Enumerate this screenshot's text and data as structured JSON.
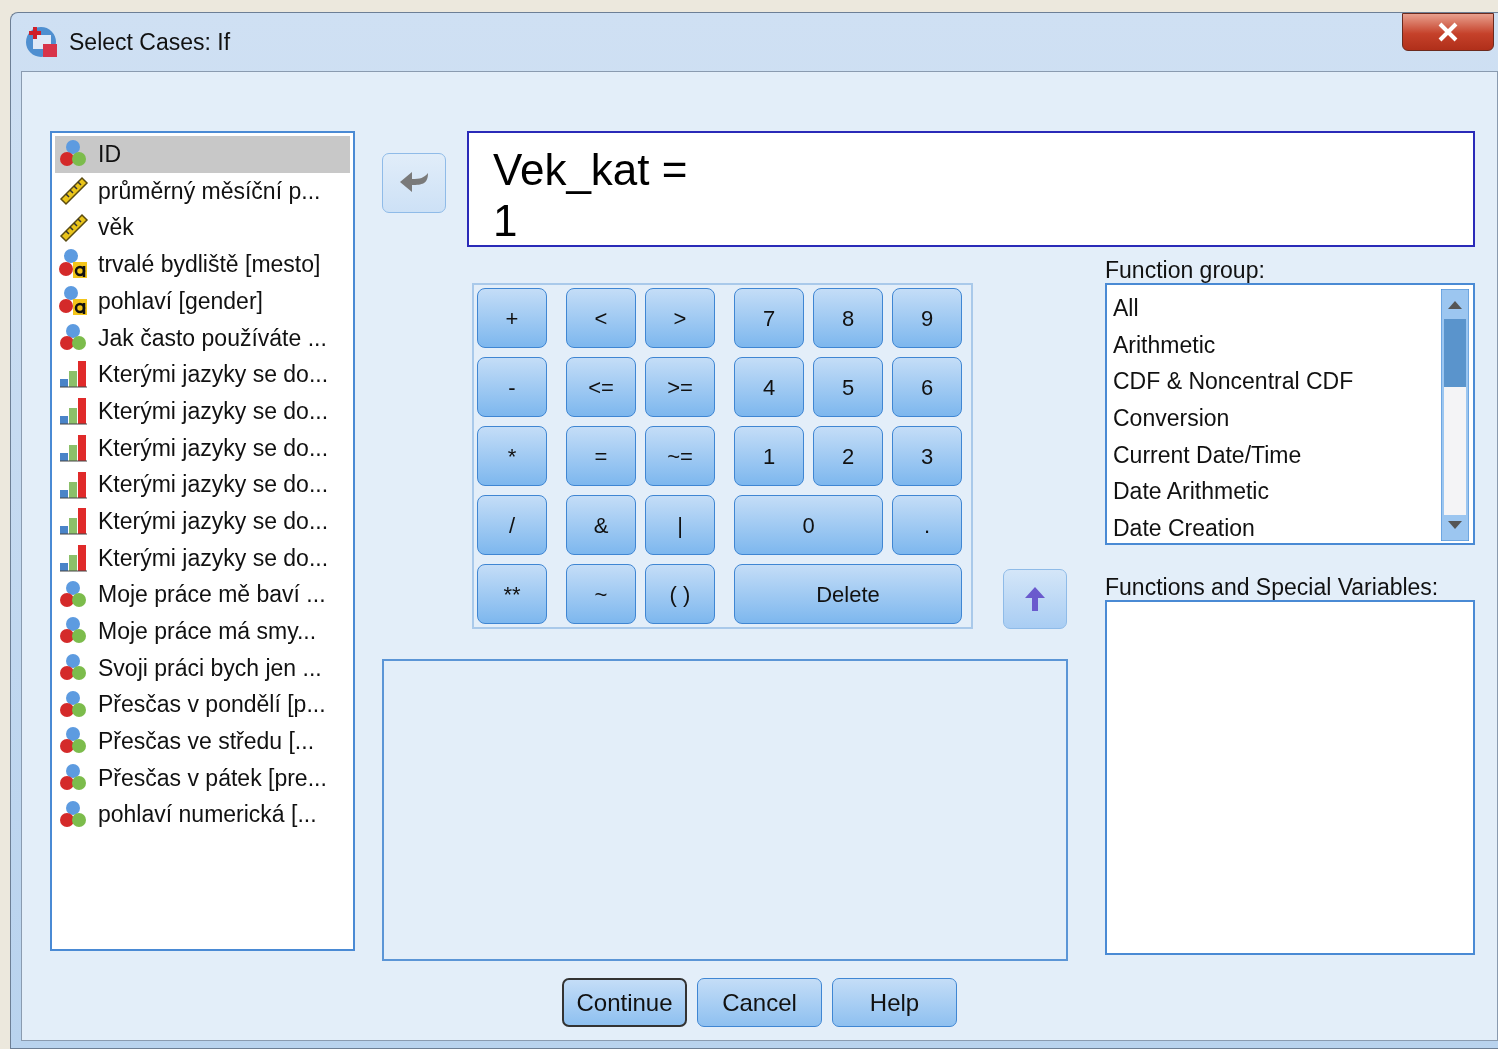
{
  "window": {
    "title": "Select Cases: If"
  },
  "variables": [
    {
      "label": "ID",
      "kind": "nominal",
      "selected": true
    },
    {
      "label": "průměrný měsíční p...",
      "kind": "scale",
      "selected": false
    },
    {
      "label": "věk",
      "kind": "scale",
      "selected": false
    },
    {
      "label": "trvalé bydliště [mesto]",
      "kind": "nominal_string",
      "selected": false
    },
    {
      "label": "pohlaví  [gender]",
      "kind": "nominal_string",
      "selected": false
    },
    {
      "label": "Jak často používáte ...",
      "kind": "nominal",
      "selected": false
    },
    {
      "label": "Kterými jazyky se do...",
      "kind": "ordinal",
      "selected": false
    },
    {
      "label": "Kterými jazyky se do...",
      "kind": "ordinal",
      "selected": false
    },
    {
      "label": "Kterými jazyky se do...",
      "kind": "ordinal",
      "selected": false
    },
    {
      "label": "Kterými jazyky se do...",
      "kind": "ordinal",
      "selected": false
    },
    {
      "label": "Kterými jazyky se do...",
      "kind": "ordinal",
      "selected": false
    },
    {
      "label": "Kterými jazyky se do...",
      "kind": "ordinal",
      "selected": false
    },
    {
      "label": "Moje práce mě baví ...",
      "kind": "nominal",
      "selected": false
    },
    {
      "label": "Moje práce má smy...",
      "kind": "nominal",
      "selected": false
    },
    {
      "label": "Svoji práci bych jen ...",
      "kind": "nominal",
      "selected": false
    },
    {
      "label": "Přesčas v pondělí [p...",
      "kind": "nominal",
      "selected": false
    },
    {
      "label": "Přesčas ve středu [...",
      "kind": "nominal",
      "selected": false
    },
    {
      "label": "Přesčas v pátek [pre...",
      "kind": "nominal",
      "selected": false
    },
    {
      "label": "pohlaví numerická [...",
      "kind": "nominal",
      "selected": false
    }
  ],
  "expression": "Vek_kat =\n1",
  "keypad": [
    {
      "kind": "operators",
      "keys": [
        {
          "label": "+",
          "kind": "normal"
        },
        {
          "label": "-",
          "kind": "normal"
        },
        {
          "label": "*",
          "kind": "normal"
        },
        {
          "label": "/",
          "kind": "normal"
        },
        {
          "label": "**",
          "kind": "normal"
        }
      ]
    },
    {
      "kind": "relations",
      "keys": [
        {
          "label": "<",
          "kind": "normal"
        },
        {
          "label": ">",
          "kind": "normal"
        },
        {
          "label": "<=",
          "kind": "normal"
        },
        {
          "label": ">=",
          "kind": "normal"
        },
        {
          "label": "=",
          "kind": "normal"
        },
        {
          "label": "~=",
          "kind": "normal"
        },
        {
          "label": "&",
          "kind": "normal"
        },
        {
          "label": "|",
          "kind": "normal"
        },
        {
          "label": "~",
          "kind": "normal"
        },
        {
          "label": "( )",
          "kind": "normal"
        }
      ]
    },
    {
      "kind": "digits",
      "keys": [
        {
          "label": "7",
          "kind": "normal"
        },
        {
          "label": "8",
          "kind": "normal"
        },
        {
          "label": "9",
          "kind": "normal"
        },
        {
          "label": "4",
          "kind": "normal"
        },
        {
          "label": "5",
          "kind": "normal"
        },
        {
          "label": "6",
          "kind": "normal"
        },
        {
          "label": "1",
          "kind": "normal"
        },
        {
          "label": "2",
          "kind": "normal"
        },
        {
          "label": "3",
          "kind": "normal"
        },
        {
          "label": "0",
          "kind": "wide"
        },
        {
          "label": ".",
          "kind": "normal"
        },
        {
          "label": "Delete",
          "kind": "full"
        }
      ]
    }
  ],
  "function_group": {
    "label": "Function group:",
    "items": [
      "All",
      "Arithmetic",
      "CDF & Noncentral CDF",
      "Conversion",
      "Current Date/Time",
      "Date Arithmetic",
      "Date Creation"
    ]
  },
  "functions": {
    "label": "Functions and Special Variables:"
  },
  "buttons": [
    {
      "label": "Continue",
      "default": true
    },
    {
      "label": "Cancel",
      "default": false
    },
    {
      "label": "Help",
      "default": false
    }
  ]
}
